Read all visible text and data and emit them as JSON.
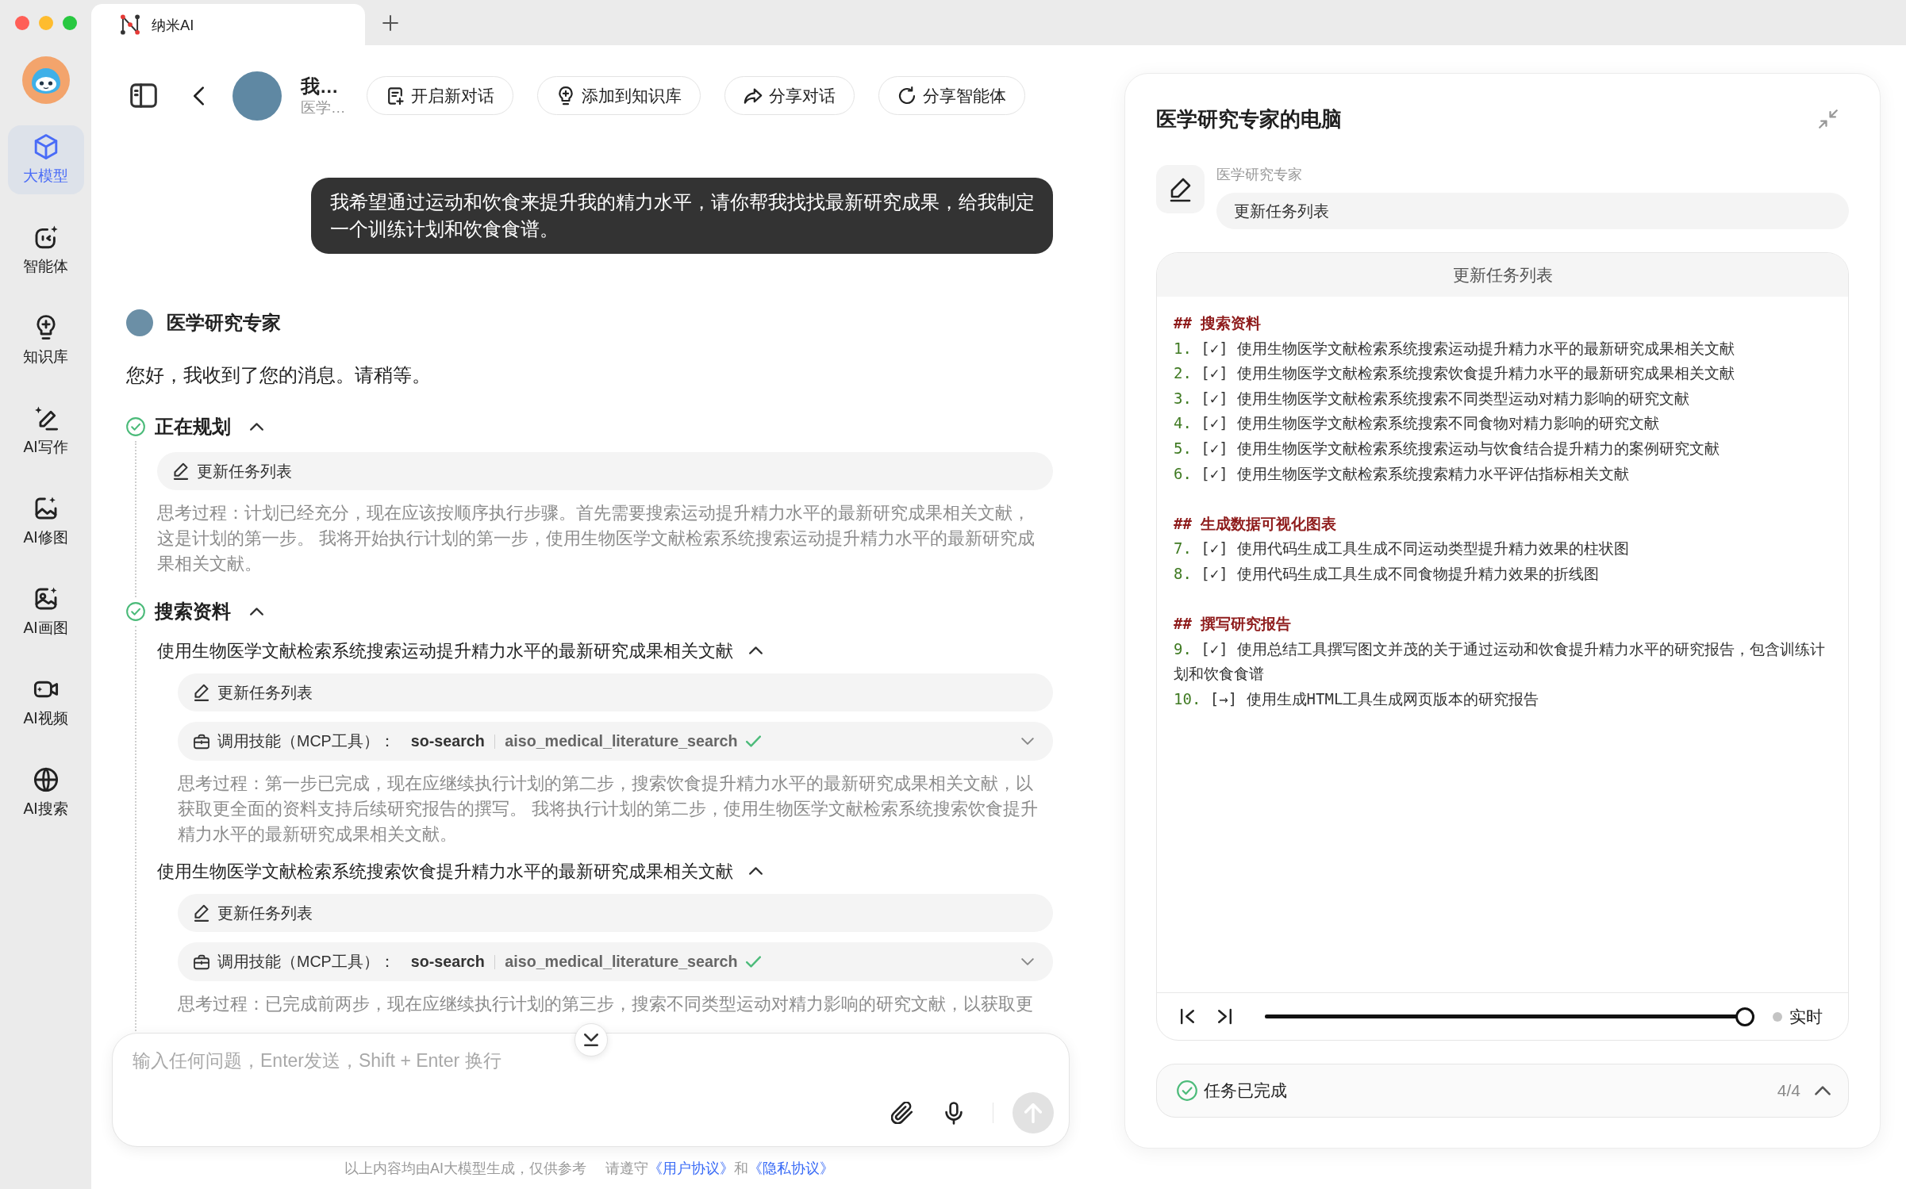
{
  "window": {
    "tab_title": "纳米AI"
  },
  "sidebar": {
    "items": [
      {
        "label": "大模型",
        "selected": true
      },
      {
        "label": "智能体",
        "selected": false
      },
      {
        "label": "知识库",
        "selected": false
      },
      {
        "label": "AI写作",
        "selected": false
      },
      {
        "label": "AI修图",
        "selected": false
      },
      {
        "label": "AI画图",
        "selected": false
      },
      {
        "label": "AI视频",
        "selected": false
      },
      {
        "label": "AI搜索",
        "selected": false
      }
    ]
  },
  "header": {
    "agent_name": "我…",
    "agent_subtitle": "医学…",
    "actions": [
      {
        "label": "开启新对话"
      },
      {
        "label": "添加到知识库"
      },
      {
        "label": "分享对话"
      },
      {
        "label": "分享智能体"
      }
    ]
  },
  "chat": {
    "user_message": "我希望通过运动和饮食来提升我的精力水平，请你帮我找找最新研究成果，给我制定一个训练计划和饮食食谱。",
    "assistant_name": "医学研究专家",
    "greeting": "您好，我收到了您的消息。请稍等。",
    "steps": [
      {
        "title": "正在规划",
        "done": true,
        "expanded": true,
        "items": [
          {
            "kind": "tool",
            "label": "更新任务列表"
          },
          {
            "kind": "thought",
            "text": "思考过程：计划已经充分，现在应该按顺序执行步骤。首先需要搜索运动提升精力水平的最新研究成果相关文献，这是计划的第一步。 我将开始执行计划的第一步，使用生物医学文献检索系统搜索运动提升精力水平的最新研究成果相关文献。"
          }
        ]
      },
      {
        "title": "搜索资料",
        "done": true,
        "expanded": true,
        "items": [
          {
            "kind": "substep",
            "title": "使用生物医学文献检索系统搜索运动提升精力水平的最新研究成果相关文献",
            "expanded": true,
            "items": [
              {
                "kind": "tool",
                "label": "更新任务列表"
              },
              {
                "kind": "skill",
                "label": "调用技能（MCP工具）：",
                "server": "so-search",
                "tool": "aiso_medical_literature_search",
                "done": true,
                "expanded": false
              },
              {
                "kind": "thought",
                "text": "思考过程：第一步已完成，现在应继续执行计划的第二步，搜索饮食提升精力水平的最新研究成果相关文献，以获取更全面的资料支持后续研究报告的撰写。 我将执行计划的第二步，使用生物医学文献检索系统搜索饮食提升精力水平的最新研究成果相关文献。"
              }
            ]
          },
          {
            "kind": "substep",
            "title": "使用生物医学文献检索系统搜索饮食提升精力水平的最新研究成果相关文献",
            "expanded": true,
            "items": [
              {
                "kind": "tool",
                "label": "更新任务列表"
              },
              {
                "kind": "skill",
                "label": "调用技能（MCP工具）：",
                "server": "so-search",
                "tool": "aiso_medical_literature_search",
                "done": true,
                "expanded": false
              },
              {
                "kind": "thought",
                "text": "思考过程：已完成前两步，现在应继续执行计划的第三步，搜索不同类型运动对精力影响的研究文献，以获取更"
              }
            ]
          }
        ]
      }
    ]
  },
  "composer": {
    "placeholder": "输入任何问题，Enter发送，Shift + Enter 换行"
  },
  "footer": {
    "disclaimer": "以上内容均由AI大模型生成，仅供参考",
    "notice": "请遵守",
    "user_agreement": "《用户协议》",
    "joiner": "和",
    "privacy_policy": "《隐私协议》"
  },
  "computer_panel": {
    "title": "医学研究专家的电脑",
    "agent_label": "医学研究专家",
    "current_action": "更新任务列表",
    "document": {
      "title": "更新任务列表",
      "sections": [
        {
          "heading": "## 搜索资料",
          "items": [
            {
              "number": "1.",
              "mark": "[✓]",
              "text": "使用生物医学文献检索系统搜索运动提升精力水平的最新研究成果相关文献"
            },
            {
              "number": "2.",
              "mark": "[✓]",
              "text": "使用生物医学文献检索系统搜索饮食提升精力水平的最新研究成果相关文献"
            },
            {
              "number": "3.",
              "mark": "[✓]",
              "text": "使用生物医学文献检索系统搜索不同类型运动对精力影响的研究文献"
            },
            {
              "number": "4.",
              "mark": "[✓]",
              "text": "使用生物医学文献检索系统搜索不同食物对精力影响的研究文献"
            },
            {
              "number": "5.",
              "mark": "[✓]",
              "text": "使用生物医学文献检索系统搜索运动与饮食结合提升精力的案例研究文献"
            },
            {
              "number": "6.",
              "mark": "[✓]",
              "text": "使用生物医学文献检索系统搜索精力水平评估指标相关文献"
            }
          ]
        },
        {
          "heading": "## 生成数据可视化图表",
          "items": [
            {
              "number": "7.",
              "mark": "[✓]",
              "text": "使用代码生成工具生成不同运动类型提升精力效果的柱状图"
            },
            {
              "number": "8.",
              "mark": "[✓]",
              "text": "使用代码生成工具生成不同食物提升精力效果的折线图"
            }
          ]
        },
        {
          "heading": "## 撰写研究报告",
          "items": [
            {
              "number": "9.",
              "mark": "[✓]",
              "text": "使用总结工具撰写图文并茂的关于通过运动和饮食提升精力水平的研究报告，包含训练计划和饮食食谱"
            },
            {
              "number": "10.",
              "mark": "[→]",
              "text": "使用生成HTML工具生成网页版本的研究报告"
            }
          ]
        }
      ]
    },
    "playback": {
      "level": 1,
      "live_label": "实时"
    },
    "status": {
      "label": "任务已完成",
      "count": "4/4"
    }
  }
}
